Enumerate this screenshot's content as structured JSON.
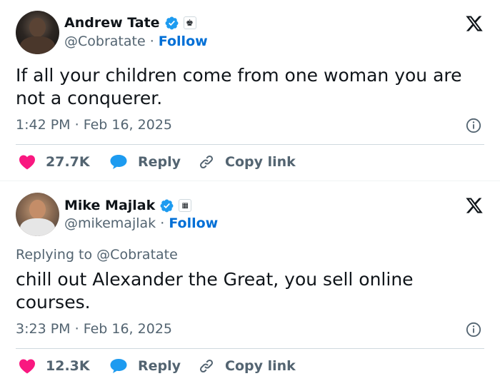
{
  "tweets": [
    {
      "author": {
        "name": "Andrew Tate",
        "handle": "@Cobratate"
      },
      "follow_label": "Follow",
      "separator": "·",
      "reply_to": null,
      "text": "If all your children come from one woman you are not a conquerer.",
      "time": "1:42 PM",
      "date": "Feb 16, 2025",
      "likes": "27.7K",
      "reply_label": "Reply",
      "copy_label": "Copy link",
      "affiliate_icon": "chess-king-badge-icon"
    },
    {
      "author": {
        "name": "Mike Majlak",
        "handle": "@mikemajlak"
      },
      "follow_label": "Follow",
      "separator": "·",
      "reply_to": {
        "prefix": "Replying to",
        "mention": "@Cobratate"
      },
      "text": "chill out Alexander the Great, you sell online courses.",
      "time": "3:23 PM",
      "date": "Feb 16, 2025",
      "likes": "12.3K",
      "reply_label": "Reply",
      "copy_label": "Copy link",
      "affiliate_icon": "logo-badge-icon"
    }
  ],
  "colors": {
    "verified": "#1d9bf0",
    "like": "#f91880",
    "reply": "#1d9bf0",
    "follow": "#006fd6",
    "secondary_text": "#536471"
  },
  "icons": [
    "verified-badge-icon",
    "x-logo-icon",
    "info-icon",
    "heart-icon",
    "reply-bubble-icon",
    "link-icon"
  ]
}
